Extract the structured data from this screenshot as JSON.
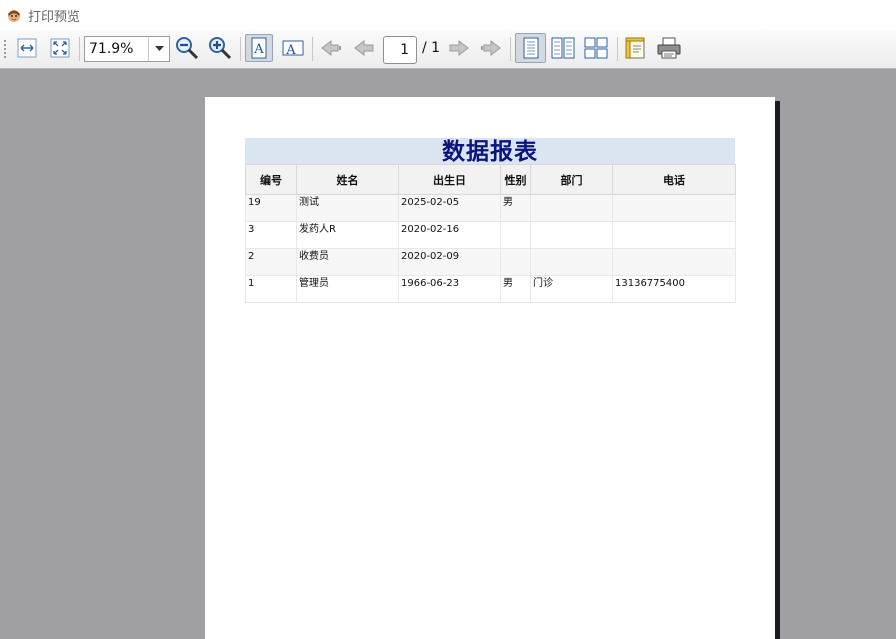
{
  "window": {
    "title": "打印预览",
    "app_icon": "app-icon"
  },
  "toolbar": {
    "zoom_value": "71.9%",
    "current_page": "1",
    "page_total": "/ 1",
    "buttons": [
      "fit-width-icon",
      "fit-page-icon",
      "zoom-out-icon",
      "zoom-in-icon",
      "portrait-icon",
      "landscape-icon",
      "first-page-icon",
      "prev-page-icon",
      "next-page-icon",
      "last-page-icon",
      "single-page-icon",
      "facing-pages-icon",
      "overview-icon",
      "page-setup-icon",
      "print-icon"
    ]
  },
  "report": {
    "title": "数据报表",
    "title_color": "#0a1480",
    "columns": [
      "编号",
      "姓名",
      "出生日",
      "性别",
      "部门",
      "电话"
    ],
    "rows": [
      {
        "id": "19",
        "name": "测试",
        "birth": "2025-02-05",
        "gender": "男",
        "dept": "",
        "phone": ""
      },
      {
        "id": "3",
        "name": "发药人R",
        "birth": "2020-02-16",
        "gender": "",
        "dept": "",
        "phone": ""
      },
      {
        "id": "2",
        "name": "收费员",
        "birth": "2020-02-09",
        "gender": "",
        "dept": "",
        "phone": ""
      },
      {
        "id": "1",
        "name": "管理员",
        "birth": "1966-06-23",
        "gender": "男",
        "dept": "门诊",
        "phone": "13136775400"
      }
    ]
  }
}
